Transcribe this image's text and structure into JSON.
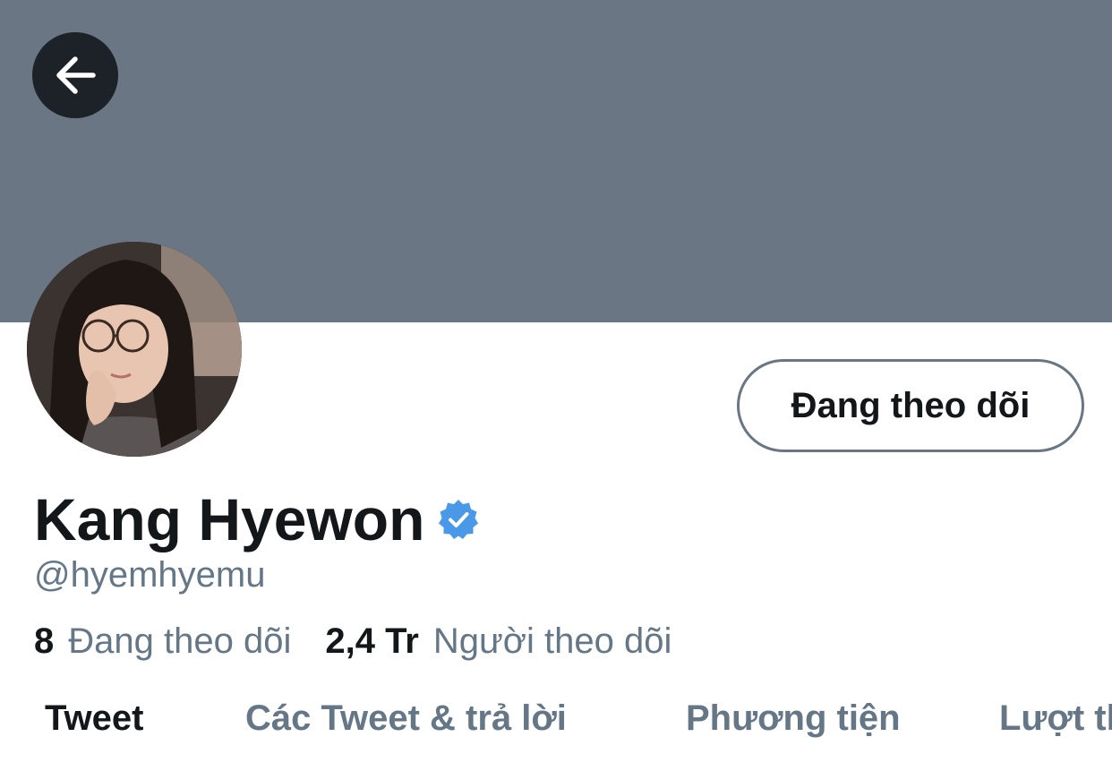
{
  "header": {
    "back_icon": "arrow-left-icon",
    "banner_color": "#6a7683"
  },
  "profile": {
    "display_name": "Kang Hyewon",
    "handle": "@hyemhyemu",
    "verified_icon": "verified-badge-icon",
    "verified_color": "#4a99e9",
    "follow_button_label": "Đang theo dõi"
  },
  "stats": {
    "following_count": "8",
    "following_label": "Đang theo dõi",
    "followers_count": "2,4 Tr",
    "followers_label": "Người theo dõi"
  },
  "tabs": [
    {
      "label": "Tweet",
      "active": true
    },
    {
      "label": "Các Tweet & trả lời",
      "active": false
    },
    {
      "label": "Phương tiện",
      "active": false
    },
    {
      "label": "Lượt thích",
      "active": false
    }
  ]
}
